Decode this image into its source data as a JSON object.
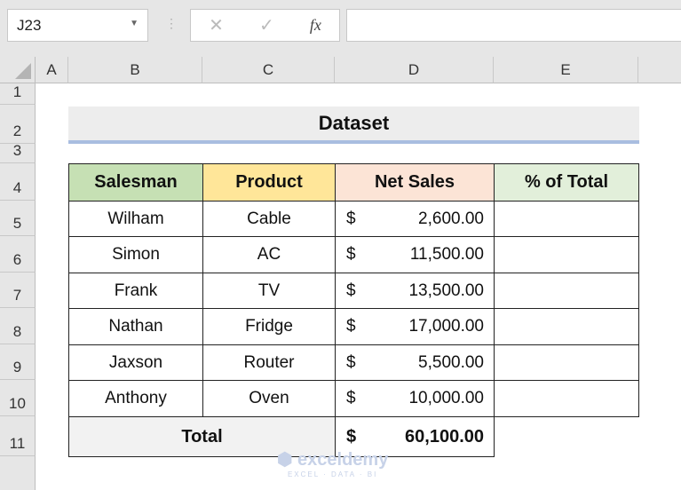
{
  "name_box": "J23",
  "formula_bar": {
    "cancel_icon": "✕",
    "enter_icon": "✓",
    "fx_label": "fx",
    "value": ""
  },
  "columns": [
    "A",
    "B",
    "C",
    "D",
    "E"
  ],
  "rows": [
    "1",
    "2",
    "3",
    "4",
    "5",
    "6",
    "7",
    "8",
    "9",
    "10",
    "11"
  ],
  "title": "Dataset",
  "headers": [
    "Salesman",
    "Product",
    "Net Sales",
    "% of Total"
  ],
  "header_colors": [
    "#c6e0b4",
    "#ffe699",
    "#fce4d6",
    "#e2efda"
  ],
  "data": [
    {
      "salesman": "Wilham",
      "product": "Cable",
      "currency": "$",
      "sales": "2,600.00",
      "pct": ""
    },
    {
      "salesman": "Simon",
      "product": "AC",
      "currency": "$",
      "sales": "11,500.00",
      "pct": ""
    },
    {
      "salesman": "Frank",
      "product": "TV",
      "currency": "$",
      "sales": "13,500.00",
      "pct": ""
    },
    {
      "salesman": "Nathan",
      "product": "Fridge",
      "currency": "$",
      "sales": "17,000.00",
      "pct": ""
    },
    {
      "salesman": "Jaxson",
      "product": "Router",
      "currency": "$",
      "sales": "5,500.00",
      "pct": ""
    },
    {
      "salesman": "Anthony",
      "product": "Oven",
      "currency": "$",
      "sales": "10,000.00",
      "pct": ""
    }
  ],
  "total": {
    "label": "Total",
    "currency": "$",
    "value": "60,100.00"
  },
  "watermark": {
    "name": "exceldemy",
    "tagline": "EXCEL · DATA · BI"
  }
}
